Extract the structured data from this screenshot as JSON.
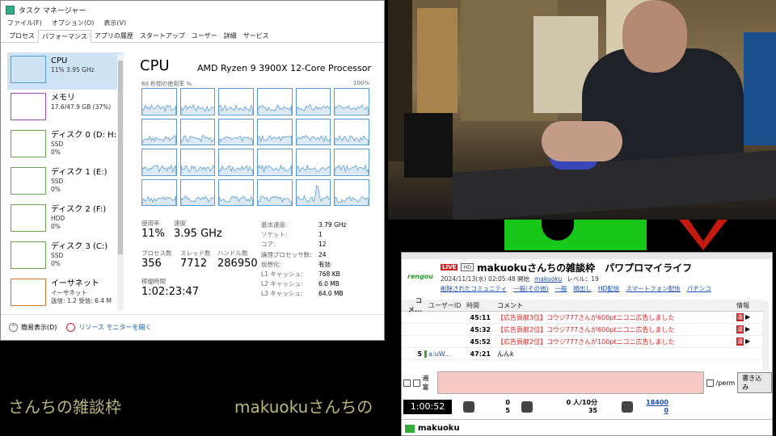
{
  "task_manager": {
    "title": "タスク マネージャー",
    "menu": [
      "ファイル(F)",
      "オプション(O)",
      "表示(V)"
    ],
    "tabs": [
      "プロセス",
      "パフォーマンス",
      "アプリの履歴",
      "スタートアップ",
      "ユーザー",
      "詳細",
      "サービス"
    ],
    "sidebar": [
      {
        "name": "CPU",
        "line1": "11%  3.95 GHz",
        "line2": "",
        "line3": "",
        "color": "#5a9bd5"
      },
      {
        "name": "メモリ",
        "line1": "17.6/47.9 GB (37%)",
        "line2": "",
        "line3": "",
        "color": "#a04cb3"
      },
      {
        "name": "ディスク 0 (D: H:)",
        "line1": "SSD",
        "line2": "0%",
        "line3": "",
        "color": "#6aa84f"
      },
      {
        "name": "ディスク 1 (E:)",
        "line1": "SSD",
        "line2": "0%",
        "line3": "",
        "color": "#6aa84f"
      },
      {
        "name": "ディスク 2 (F:)",
        "line1": "HDD",
        "line2": "0%",
        "line3": "",
        "color": "#6aa84f"
      },
      {
        "name": "ディスク 3 (C:)",
        "line1": "SSD",
        "line2": "0%",
        "line3": "",
        "color": "#6aa84f"
      },
      {
        "name": "イーサネット",
        "line1": "イーサネット",
        "line2": "送信: 1.2  受信: 6.4 M",
        "line3": "",
        "color": "#c87932"
      }
    ],
    "cpu": {
      "title": "CPU",
      "model": "AMD Ryzen 9 3900X 12-Core Processor",
      "util_label": "60 秒間の使用率 %",
      "util_max": "100%",
      "usage_label": "使用率",
      "usage_value": "11%",
      "speed_label": "速度",
      "speed_value": "3.95 GHz",
      "process_label": "プロセス数",
      "process_value": "356",
      "thread_label": "スレッド数",
      "thread_value": "7712",
      "handle_label": "ハンドル数",
      "handle_value": "286950",
      "uptime_label": "稼働時間",
      "uptime_value": "1:02:23:47",
      "specs": [
        {
          "k": "基本速度:",
          "v": "3.79 GHz"
        },
        {
          "k": "ソケット:",
          "v": "1"
        },
        {
          "k": "コア:",
          "v": "12"
        },
        {
          "k": "論理プロセッサ数:",
          "v": "24"
        },
        {
          "k": "仮想化:",
          "v": "有効"
        },
        {
          "k": "L1 キャッシュ:",
          "v": "768 KB"
        },
        {
          "k": "L2 キャッシュ:",
          "v": "6.0 MB"
        },
        {
          "k": "L3 キャッシュ:",
          "v": "64.0 MB"
        }
      ]
    },
    "footer": {
      "compact": "簡易表示(D)",
      "monitor": "リソース モニターを開く"
    }
  },
  "marquee": {
    "left": "さんちの雑談枠",
    "right": "makuokuさんちの"
  },
  "viewer": {
    "live": "LIVE",
    "hd": "HD",
    "logo": "rengou",
    "title": "makuokuさんちの雑談枠　パワプロマイライフ",
    "date": "2024/11/13(水) 02:05:48 開始",
    "owner": "makuoku",
    "level": "レベル：19",
    "tags": [
      "削除されたコミュニティ",
      "一般(その他)",
      "一般",
      "顔出し",
      "HD配信",
      "スマートフォン配信",
      "パチンコ"
    ],
    "headers": {
      "no": "コメ...",
      "uid": "ユーザーID",
      "time": "時間",
      "comment": "コメント",
      "info": "情報"
    },
    "rows": [
      {
        "no": "",
        "uid": "",
        "time": "45:11",
        "comment": "【広告貢献3位】コウジ777さんが600ptニコニ広告しました",
        "kind": "ad"
      },
      {
        "no": "",
        "uid": "",
        "time": "45:32",
        "comment": "【広告貢献2位】コウジ777さんが600ptニコニ広告しました",
        "kind": "ad"
      },
      {
        "no": "",
        "uid": "",
        "time": "45:52",
        "comment": "【広告貢献2位】コウジ777さんが100ptニコニ広告しました",
        "kind": "ad"
      },
      {
        "no": "5",
        "uid": "a:uW...",
        "time": "47:21",
        "comment": "んんk",
        "kind": "normal"
      }
    ],
    "info_tag": "運",
    "checkbox_label": "遍富",
    "perm": "/perm",
    "post": "書き込み",
    "clock": "1:00:52",
    "stats": [
      {
        "top": "0",
        "bottom": "5"
      },
      {
        "top": "0 人/10分",
        "bottom": "35"
      },
      {
        "top": "18400",
        "bottom": "0"
      }
    ],
    "user": "makuoku"
  }
}
